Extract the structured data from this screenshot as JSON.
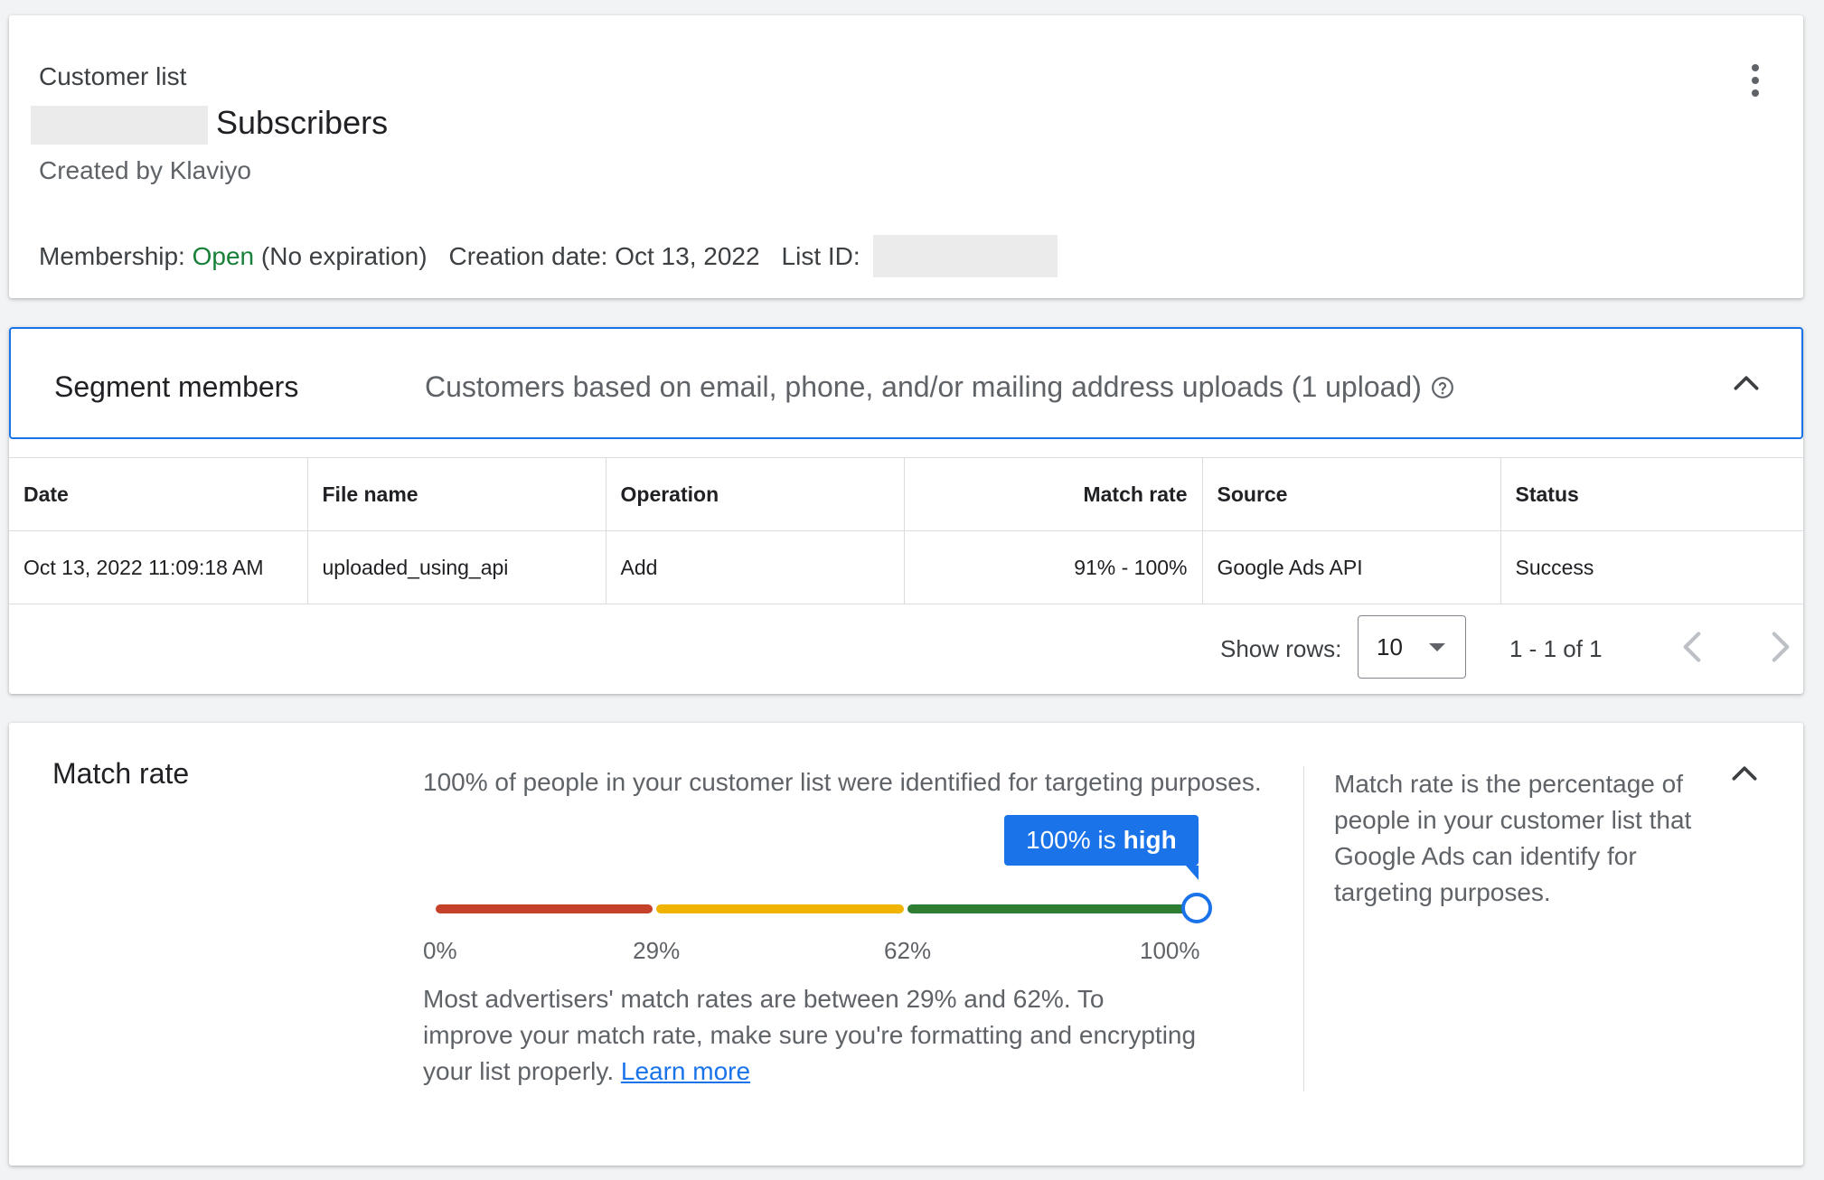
{
  "header": {
    "list_type": "Customer list",
    "list_name": "Subscribers",
    "created_by": "Created by Klaviyo",
    "membership_label": "Membership:",
    "membership_status": "Open",
    "membership_expiration": "(No expiration)",
    "creation_date": "Creation date: Oct 13, 2022",
    "list_id_label": "List ID:"
  },
  "segment": {
    "title": "Segment members",
    "description": "Customers based on email, phone, and/or mailing address uploads (1 upload)",
    "columns": [
      "Date",
      "File name",
      "Operation",
      "Match rate",
      "Source",
      "Status"
    ],
    "rows": [
      [
        "Oct 13, 2022 11:09:18 AM",
        "uploaded_using_api",
        "Add",
        "91% - 100%",
        "Google Ads API",
        "Success"
      ]
    ],
    "pager": {
      "show_rows_label": "Show rows:",
      "rows_value": "10",
      "range": "1 - 1 of 1"
    }
  },
  "match_rate": {
    "title": "Match rate",
    "summary": "100% of people in your customer list were identified for targeting purposes.",
    "value_percent": 100,
    "thresholds": [
      29,
      62
    ],
    "tick_labels": [
      "0%",
      "29%",
      "62%",
      "100%"
    ],
    "tooltip_value": "100% is",
    "tooltip_level": "high",
    "note": "Most advertisers' match rates are between 29% and 62%. To improve your match rate, make sure you're formatting and encrypting your list properly.",
    "learn_more": "Learn more",
    "explanation": "Match rate is the percentage of people in your customer list that Google Ads can identify for targeting purposes.",
    "colors": {
      "low": "#c5412a",
      "medium": "#f0b400",
      "high": "#2e7d32",
      "accent": "#1a73e8"
    }
  }
}
